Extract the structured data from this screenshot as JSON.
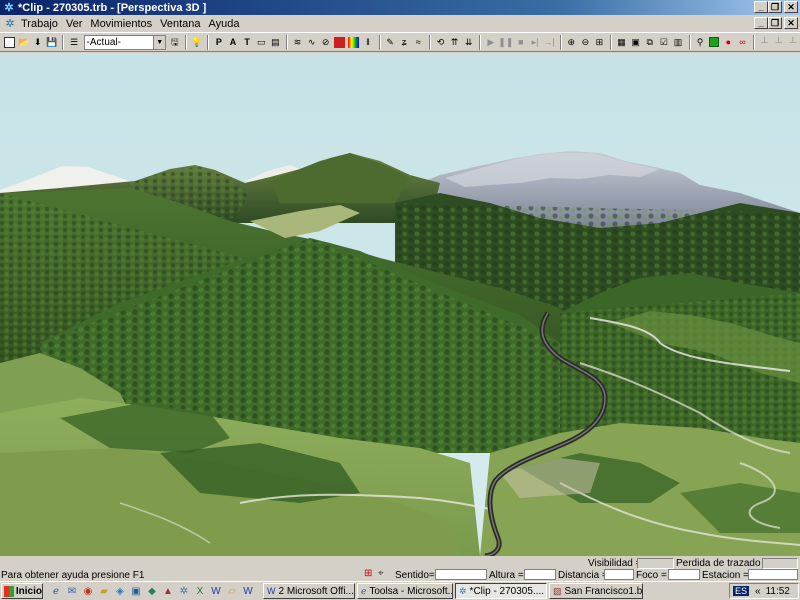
{
  "window": {
    "title": "*Clip - 270305.trb - [Perspectiva 3D ]",
    "app_icon": "compass-star-icon"
  },
  "menu": {
    "items": [
      "Trabajo",
      "Ver",
      "Movimientos",
      "Ventana",
      "Ayuda"
    ]
  },
  "toolbar": {
    "view_select_value": "-Actual-",
    "tools": [
      "new-icon",
      "open-icon",
      "import-icon",
      "save-icon",
      "list-icon",
      "dropdown",
      "save-view-icon",
      "help-icon",
      "view-p-icon",
      "view-a-icon",
      "view-t-icon",
      "view-window-icon",
      "view-panel-icon",
      "layers-icon",
      "route-icon",
      "no-route-icon",
      "color-icon",
      "palette-icon",
      "bars-icon",
      "draw-icon",
      "curve-icon",
      "sketch-icon",
      "rotate-icon",
      "up-arrows-icon",
      "down-arrows-icon",
      "play-icon",
      "pause-icon",
      "stop-icon",
      "step-icon",
      "end-icon",
      "axis-icon",
      "axis2-icon",
      "grid-icon",
      "table-icon",
      "frame-icon",
      "copy-icon",
      "check-icon",
      "panel-icon",
      "link-icon",
      "green-box-icon",
      "record-icon",
      "glasses-icon",
      "chart1-icon",
      "chart2-icon",
      "chart3-icon"
    ]
  },
  "status": {
    "help_text": "Para obtener ayuda presione F1",
    "visibilidad_label": "Visibilidad =",
    "perdida_label": "Perdida de trazado =",
    "sentido_label": "Sentido=",
    "altura_label": "Altura =",
    "distancia_label": "Distancia =",
    "foco_label": "Foco =",
    "estacion_label": "Estacion ="
  },
  "taskbar": {
    "start_label": "Inicio",
    "quick_launch": [
      "ie-icon",
      "outlook-icon",
      "media-icon",
      "folder-icon",
      "app-icon",
      "app2-icon",
      "app3-icon",
      "app4-icon",
      "clip-icon",
      "excel-icon",
      "word-icon",
      "explorer-icon",
      "word2-icon"
    ],
    "tasks": [
      {
        "label": "2 Microsoft Offi...",
        "icon": "word-icon",
        "active": false
      },
      {
        "label": "Toolsa - Microsoft...",
        "icon": "ie-icon",
        "active": false
      },
      {
        "label": "*Clip - 270305....",
        "icon": "clip-icon",
        "active": true
      },
      {
        "label": "San Francisco1.b...",
        "icon": "paint-icon",
        "active": false
      }
    ],
    "language": "ES",
    "clock": "11:52"
  },
  "colors": {
    "title_start": "#0a246a",
    "title_end": "#a6caf0",
    "sky": "#cfe6ea",
    "forest": "#3f6a2a",
    "meadow": "#8aa460",
    "snow": "#f2f2ee",
    "rock": "#9aa0ad",
    "road": "#3a3a3a"
  }
}
